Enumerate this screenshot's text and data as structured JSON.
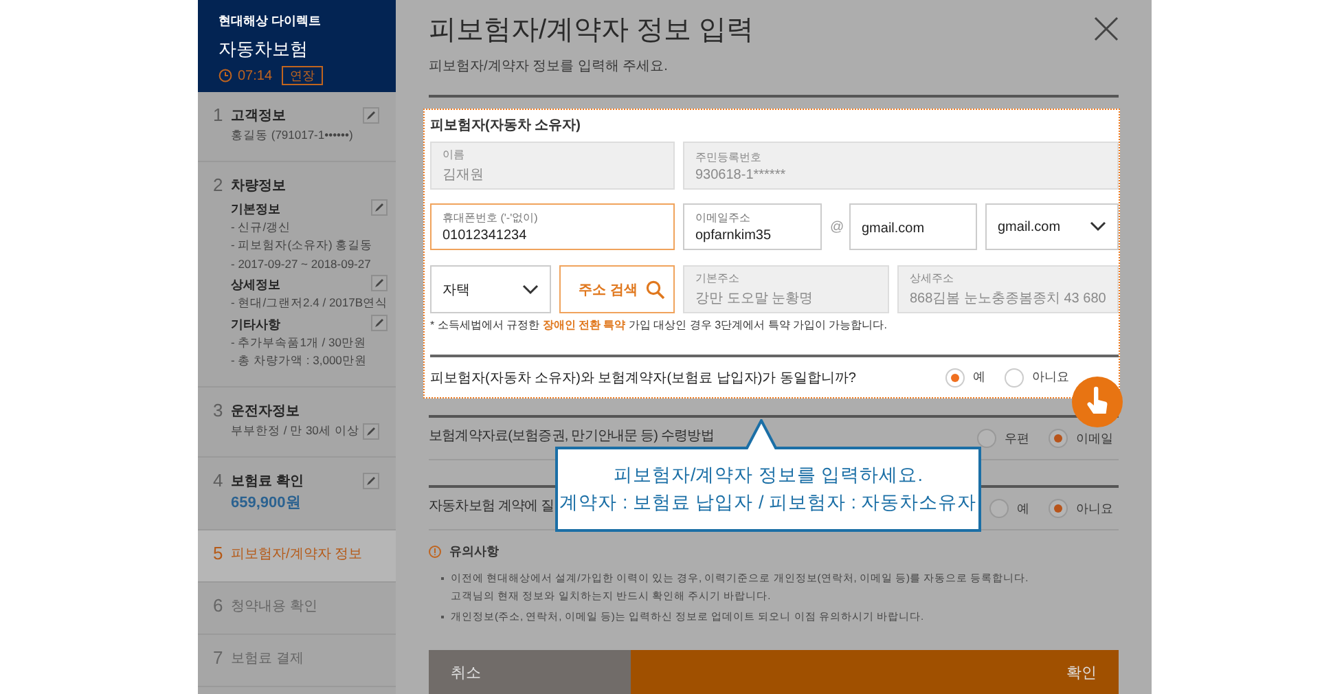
{
  "sidebar": {
    "brand": "현대해상 다이렉트",
    "product": "자동차보험",
    "timer": "07:14",
    "extend_button": "연장",
    "steps": [
      {
        "number": "1",
        "title": "고객정보",
        "selected": false,
        "disabled": false,
        "editable": true,
        "details": [
          {
            "kind": "text",
            "text": "홍길동 (791017-1••••••)",
            "editable": false
          }
        ]
      },
      {
        "number": "2",
        "title": "차량정보",
        "selected": false,
        "disabled": false,
        "editable": false,
        "details": [
          {
            "kind": "heading",
            "text": "기본정보",
            "editable": true
          },
          {
            "kind": "text",
            "text": "- 신규/갱신",
            "editable": false
          },
          {
            "kind": "text",
            "text": "- 피보험자(소유자) 홍길동",
            "editable": false
          },
          {
            "kind": "text",
            "text": "- 2017-09-27 ~ 2018-09-27",
            "editable": false
          },
          {
            "kind": "heading",
            "text": "상세정보",
            "editable": true
          },
          {
            "kind": "text",
            "text": "- 현대/그랜저2.4 / 2017B연식",
            "editable": false
          },
          {
            "kind": "heading",
            "text": "기타사항",
            "editable": true
          },
          {
            "kind": "text",
            "text": "- 추가부속품1개 / 30만원",
            "editable": false
          },
          {
            "kind": "text",
            "text": "- 총 차량가액 : 3,000만원",
            "editable": false
          }
        ]
      },
      {
        "number": "3",
        "title": "운전자정보",
        "selected": false,
        "disabled": false,
        "editable": false,
        "details": [
          {
            "kind": "text",
            "text": "부부한정 / 만 30세 이상",
            "editable": true
          }
        ]
      },
      {
        "number": "4",
        "title": "보험료 확인",
        "selected": false,
        "disabled": false,
        "editable": true,
        "details": [
          {
            "kind": "amount",
            "text": "659,900원",
            "editable": false
          }
        ]
      },
      {
        "number": "5",
        "title": "피보험자/계약자 정보",
        "selected": true,
        "disabled": false,
        "editable": false
      },
      {
        "number": "6",
        "title": "청약내용 확인",
        "selected": false,
        "disabled": true,
        "editable": false
      },
      {
        "number": "7",
        "title": "보험료 결제",
        "selected": false,
        "disabled": true,
        "editable": false
      }
    ]
  },
  "main": {
    "title": "피보험자/계약자 정보 입력",
    "subtitle": "피보험자/계약자 정보를 입력해 주세요.",
    "insured": {
      "heading": "피보험자(자동차 소유자)",
      "field_rows": [
        {
          "fields": [
            {
              "kind": "input",
              "label": "이름",
              "value": "김재원",
              "disabled": true,
              "focused": false
            },
            {
              "kind": "input",
              "label": "주민등록번호",
              "value": "930618-1******",
              "disabled": true,
              "focused": false
            }
          ]
        },
        {
          "fields": [
            {
              "kind": "input",
              "label": "휴대폰번호 ('-'없이)",
              "value": "01012341234",
              "disabled": false,
              "focused": true
            },
            {
              "kind": "input",
              "label": "이메일주소",
              "value": "opfarnkim35",
              "disabled": false,
              "focused": false
            },
            {
              "kind": "separator",
              "text": "@"
            },
            {
              "kind": "input",
              "value": "gmail.com",
              "disabled": false,
              "focused": false
            },
            {
              "kind": "select",
              "value": "gmail.com"
            }
          ]
        },
        {
          "fields": [
            {
              "kind": "select",
              "value": "자택"
            },
            {
              "kind": "search_button",
              "label": "주소 검색"
            },
            {
              "kind": "input",
              "label": "기본주소",
              "value": "강만 도오말 눈황명",
              "disabled": true,
              "focused": false
            },
            {
              "kind": "input",
              "label": "상세주소",
              "value": "868김봄 눈노충종봄종치 43 680",
              "disabled": true,
              "focused": false
            }
          ]
        }
      ],
      "note": "* 소득세법에서 규정한 **장애인 전환 특약** 가입 대상인 경우 3단계에서 특약 가입이 가능합니다.",
      "question": {
        "text": "피보험자(자동차 소유자)와 보험계약자(보험료 납입자)가 동일합니까?",
        "options": [
          {
            "label": "예",
            "selected": true
          },
          {
            "label": "아니요",
            "selected": false
          }
        ]
      }
    },
    "questions": [
      {
        "text": "보험계약자료(보험증권, 만기안내문 등) 수령방법",
        "options": [
          {
            "label": "우편",
            "selected": false
          },
          {
            "label": "이메일",
            "selected": true
          }
        ]
      },
      {
        "text": "자동차보험 계약에 질",
        "options": [
          {
            "label": "예",
            "selected": false
          },
          {
            "label": "아니요",
            "selected": true
          }
        ]
      }
    ],
    "notice": {
      "title": "유의사항",
      "items": [
        "이전에 현대해상에서 설계/가입한 이력이 있는 경우, 이력기준으로 개인정보(연락처, 이메일 등)를 자동으로 등록합니다.\n고객님의 현재 정보와 일치하는지 반드시 확인해 주시기 바랍니다.",
        "개인정보(주소, 연락처, 이메일 등)는 입력하신 정보로 업데이트 되오니 이점 유의하시기 바랍니다."
      ]
    },
    "buttons": [
      {
        "kind": "cancel",
        "label": "취소"
      },
      {
        "kind": "confirm",
        "label": "확인"
      }
    ]
  },
  "tooltip": {
    "lines": [
      "피보험자/계약자 정보를 입력하세요.",
      "계약자 : 보험료 납입자 / 피보험자 : 자동차소유자"
    ]
  }
}
